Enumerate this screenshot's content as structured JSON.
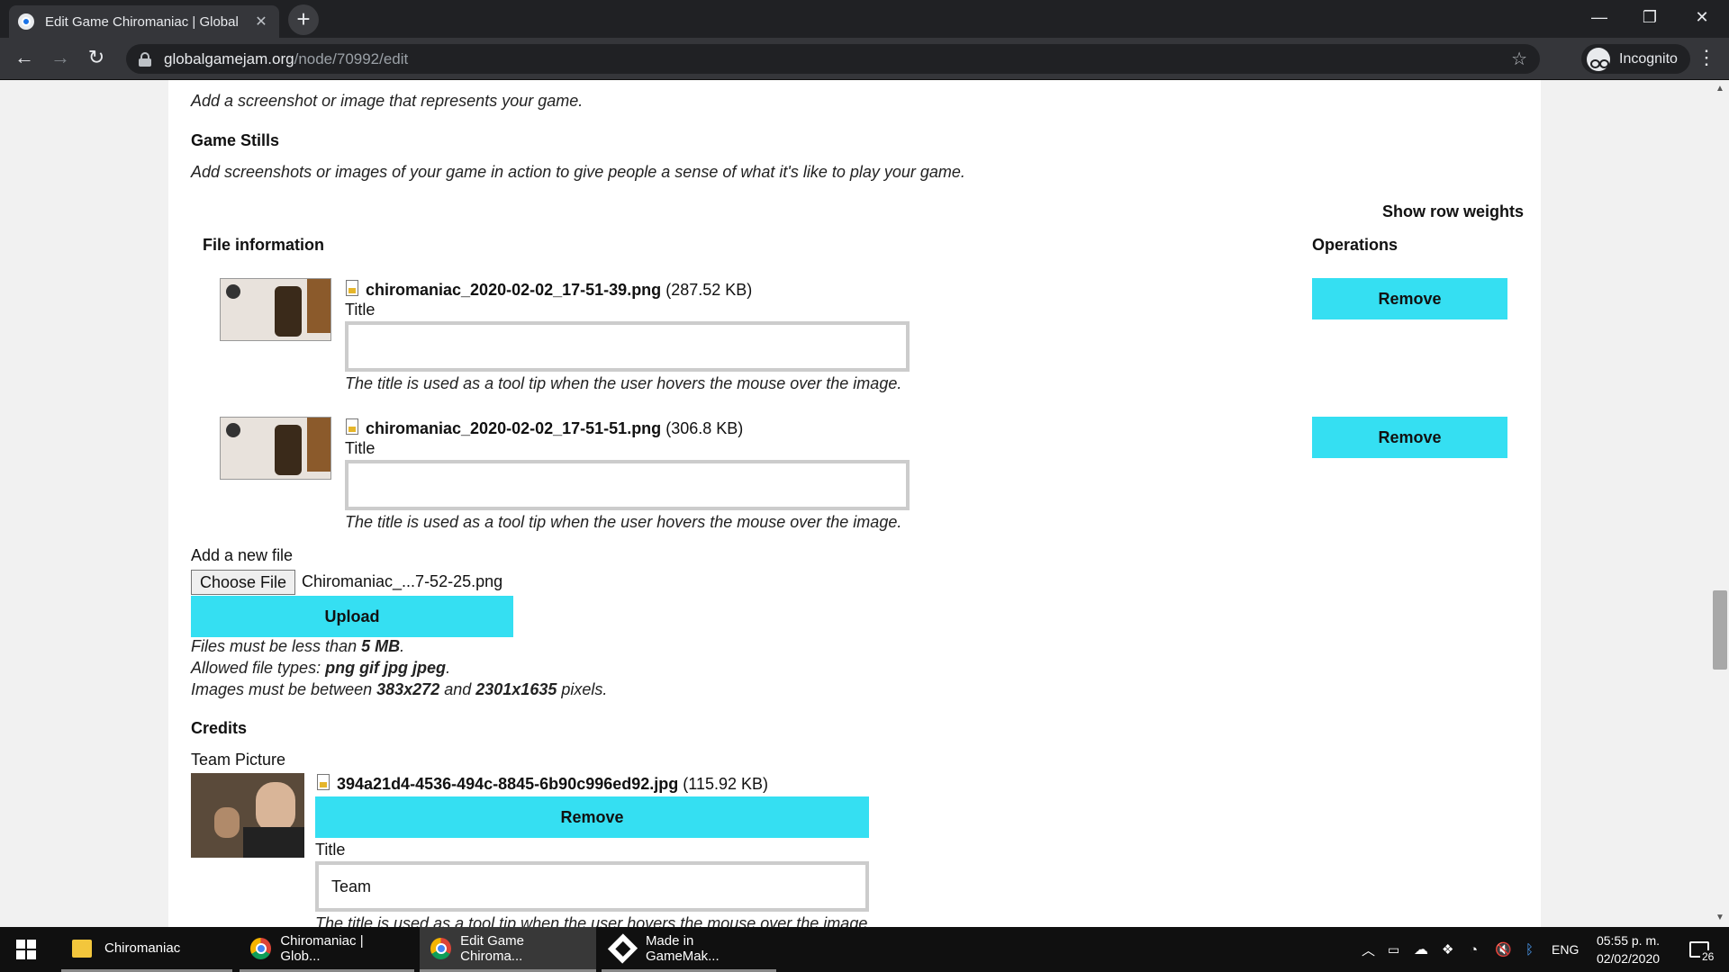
{
  "browser": {
    "tab_title": "Edit Game Chiromaniac | Global",
    "url_domain": "globalgamejam.org",
    "url_path": "/node/70992/edit",
    "incognito_label": "Incognito"
  },
  "page": {
    "image_help": "Add a screenshot or image that represents your game.",
    "game_stills_heading": "Game Stills",
    "game_stills_help": "Add screenshots or images of your game in action to give people a sense of what it's like to play your game.",
    "show_row_weights": "Show row weights",
    "table": {
      "col_file_info": "File information",
      "col_operations": "Operations",
      "rows": [
        {
          "filename": "chiromaniac_2020-02-02_17-51-39.png",
          "size": "(287.52 KB)",
          "title_label": "Title",
          "title_value": "",
          "title_help": "The title is used as a tool tip when the user hovers the mouse over the image.",
          "remove_label": "Remove"
        },
        {
          "filename": "chiromaniac_2020-02-02_17-51-51.png",
          "size": "(306.8 KB)",
          "title_label": "Title",
          "title_value": "",
          "title_help": "The title is used as a tool tip when the user hovers the mouse over the image.",
          "remove_label": "Remove"
        }
      ]
    },
    "upload": {
      "label": "Add a new file",
      "choose_label": "Choose File",
      "chosen_file": "Chiromaniac_...7-52-25.png",
      "upload_label": "Upload",
      "limit_prefix": "Files must be less than ",
      "limit_value": "5 MB",
      "limit_suffix": ".",
      "types_prefix": "Allowed file types: ",
      "types_value": "png gif jpg jpeg",
      "types_suffix": ".",
      "dims_prefix": "Images must be between ",
      "dims_min": "383x272",
      "dims_and": " and ",
      "dims_max": "2301x1635",
      "dims_suffix": " pixels."
    },
    "credits": {
      "heading": "Credits",
      "team_picture_label": "Team Picture",
      "filename": "394a21d4-4536-494c-8845-6b90c996ed92.jpg",
      "size": "(115.92 KB)",
      "remove_label": "Remove",
      "title_label": "Title",
      "title_value": "Team",
      "title_help": "The title is used as a tool tip when the user hovers the mouse over the image."
    }
  },
  "taskbar": {
    "items": [
      {
        "label": "Chiromaniac",
        "icon": "folder-icon"
      },
      {
        "label": "Chiromaniac | Glob...",
        "icon": "chrome-icon"
      },
      {
        "label": "Edit Game Chiroma...",
        "icon": "chrome-icon"
      },
      {
        "label": "Made in GameMak...",
        "icon": "gamemaker-icon"
      }
    ],
    "language": "ENG",
    "time": "05:55 p. m.",
    "date": "02/02/2020",
    "notification_count": "26"
  },
  "colors": {
    "accent_button": "#35dff2",
    "chrome_dark": "#202124",
    "taskbar": "#101010"
  }
}
